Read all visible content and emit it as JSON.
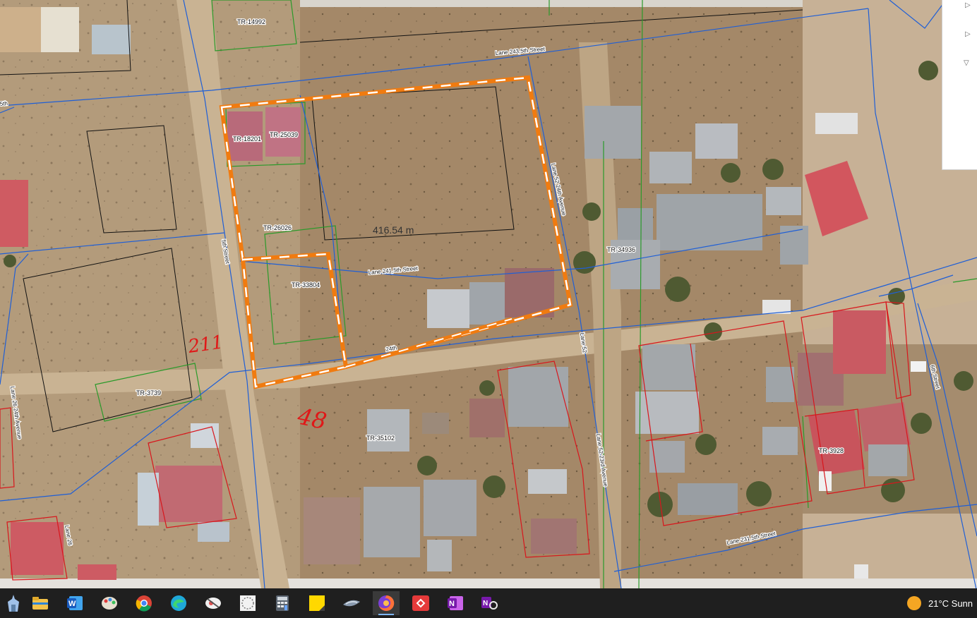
{
  "map": {
    "measure_label": "416.54 m",
    "parcel_labels": [
      "TR-14992",
      "TR-18201",
      "TR-25039",
      "TR-26026",
      "TR-33804",
      "TR-34936",
      "TR-3739",
      "TR-35102",
      "TR-3928"
    ],
    "street_labels": [
      "Lane 243,5th Street",
      "Lane 52 24th Avenue",
      "Lane 241,5th Street",
      "5th Street",
      "Lane 52",
      "Lane 52 23rd Avenue",
      "Lane 231,5th Street",
      "6th Street",
      "Lane 26 24th Avenue",
      "Lane 26",
      "5th",
      "24th"
    ],
    "handwritten_annotations": [
      "211",
      "48"
    ],
    "colors": {
      "parcel_blue": "#1f5fd6",
      "cadastral_green": "#2a9a2a",
      "selection_orange": "#f07b10",
      "boundary_red": "#d8161c",
      "ground": "#b9a182",
      "roof_grey": "#a7aaad",
      "roof_red": "#c8545c"
    }
  },
  "side_panel": {
    "expand_icons": [
      "expand-icon",
      "expand-icon",
      "collapse-icon"
    ]
  },
  "taskbar": {
    "apps": [
      {
        "name": "taskbar-start-icon"
      },
      {
        "name": "file-explorer-icon"
      },
      {
        "name": "word-icon"
      },
      {
        "name": "paint-icon"
      },
      {
        "name": "chrome-icon"
      },
      {
        "name": "edge-icon"
      },
      {
        "name": "snipping-tool-icon"
      },
      {
        "name": "app-icon"
      },
      {
        "name": "calculator-icon"
      },
      {
        "name": "sticky-notes-icon"
      },
      {
        "name": "app-icon"
      },
      {
        "name": "firefox-icon"
      },
      {
        "name": "remote-app-icon"
      },
      {
        "name": "onenote-icon"
      },
      {
        "name": "onenote-tool-icon"
      }
    ],
    "weather_text": "21°C  Sunn"
  }
}
